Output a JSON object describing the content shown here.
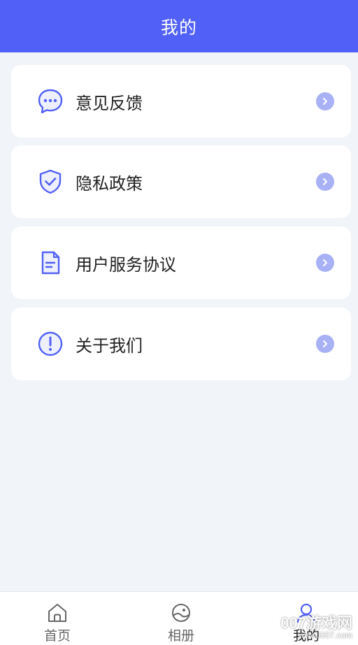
{
  "header": {
    "title": "我的"
  },
  "menu": [
    {
      "label": "意见反馈",
      "icon": "feedback-chat-icon"
    },
    {
      "label": "隐私政策",
      "icon": "privacy-shield-icon"
    },
    {
      "label": "用户服务协议",
      "icon": "agreement-document-icon"
    },
    {
      "label": "关于我们",
      "icon": "about-info-icon"
    }
  ],
  "tabbar": {
    "items": [
      {
        "label": "首页",
        "icon": "home-icon"
      },
      {
        "label": "相册",
        "icon": "album-icon"
      },
      {
        "label": "我的",
        "icon": "profile-icon",
        "active": true
      }
    ]
  },
  "watermark": {
    "line1": "007游戏网",
    "line2": "www.i007.com"
  },
  "colors": {
    "accent": "#5160f6",
    "chevron": "#a8b1f6",
    "background": "#f1f4f8"
  }
}
